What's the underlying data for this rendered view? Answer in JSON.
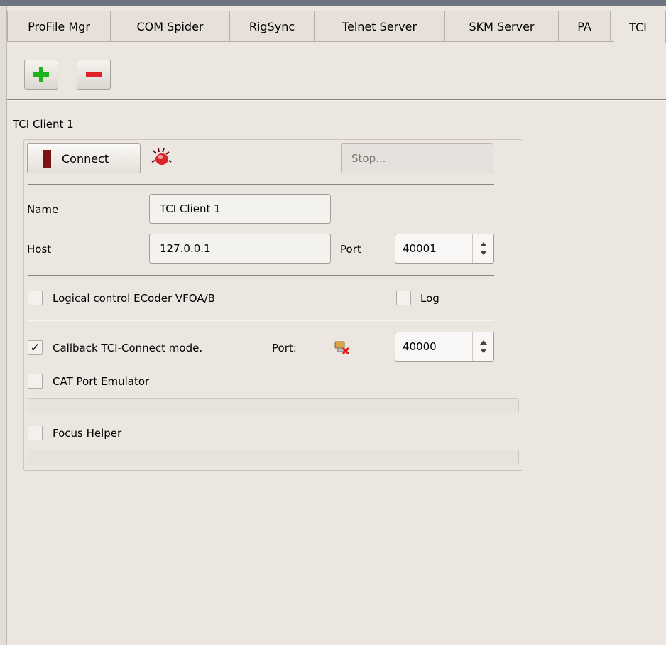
{
  "tabs": [
    {
      "label": "ProFile Mgr"
    },
    {
      "label": "COM Spider"
    },
    {
      "label": "RigSync"
    },
    {
      "label": "Telnet Server"
    },
    {
      "label": "SKM Server"
    },
    {
      "label": "PA"
    },
    {
      "label": "TCI"
    }
  ],
  "active_tab": "TCI",
  "toolbar": {
    "add_icon": "plus-icon",
    "remove_icon": "minus-icon"
  },
  "client": {
    "group_title": "TCI Client 1",
    "connect_label": "Connect",
    "status_field": "Stop...",
    "name_label": "Name",
    "name_value": "TCI Client 1",
    "host_label": "Host",
    "host_value": "127.0.0.1",
    "port_label": "Port",
    "port_value": "40001",
    "logical_control_label": "Logical control ECoder VFOA/B",
    "logical_control_checked": false,
    "log_label": "Log",
    "log_checked": false,
    "callback_label": "Callback TCI-Connect mode.",
    "callback_checked": true,
    "callback_port_label": "Port:",
    "callback_port_value": "40000",
    "cat_emulator_label": "CAT Port Emulator",
    "cat_emulator_checked": false,
    "focus_helper_label": "Focus Helper",
    "focus_helper_checked": false
  },
  "colors": {
    "add_green": "#1db31d",
    "remove_red": "#e0202a",
    "connect_indicator": "#7a1414"
  }
}
